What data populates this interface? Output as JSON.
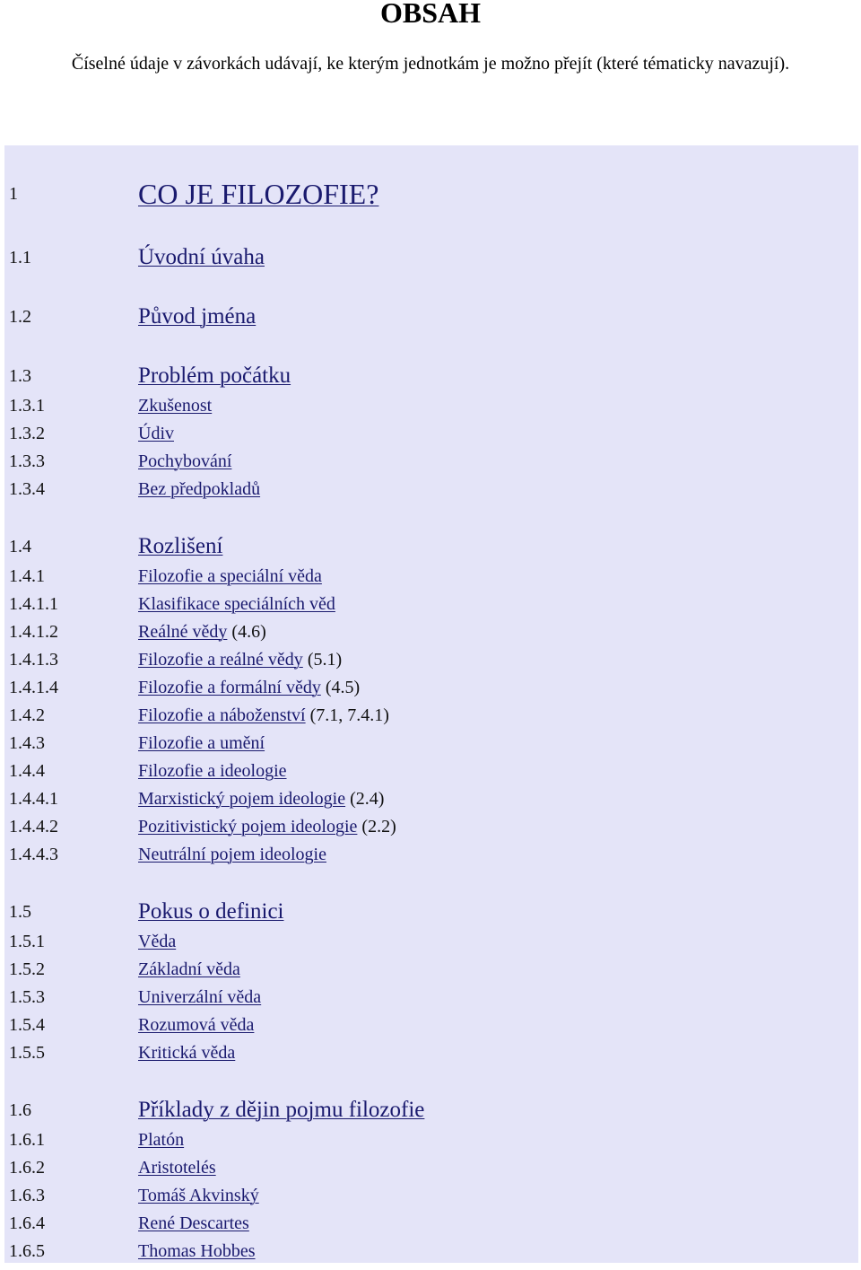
{
  "title": "OBSAH",
  "note": "Číselné údaje v závorkách udávají, ke kterým jednotkám je možno přejít (které tématicky navazují).",
  "colors": {
    "panel_bg": "#e4e4f8",
    "link": "#1a1a6e"
  },
  "toc": [
    {
      "num": "1",
      "label": "CO JE FILOZOFIE?",
      "ref": ""
    },
    {
      "num": "1.1",
      "label": "Úvodní úvaha",
      "ref": ""
    },
    {
      "num": "1.2",
      "label": "Původ jména",
      "ref": ""
    },
    {
      "num": "1.3",
      "label": "Problém počátku",
      "ref": ""
    },
    {
      "num": "1.3.1",
      "label": "Zkušenost",
      "ref": ""
    },
    {
      "num": "1.3.2",
      "label": "Údiv",
      "ref": ""
    },
    {
      "num": "1.3.3",
      "label": "Pochybování",
      "ref": ""
    },
    {
      "num": "1.3.4",
      "label": "Bez předpokladů",
      "ref": ""
    },
    {
      "num": "1.4",
      "label": "Rozlišení",
      "ref": ""
    },
    {
      "num": "1.4.1",
      "label": "Filozofie a speciální věda",
      "ref": ""
    },
    {
      "num": "1.4.1.1",
      "label": "Klasifikace speciálních věd",
      "ref": ""
    },
    {
      "num": "1.4.1.2",
      "label": "Reálné vědy",
      "ref": " (4.6)"
    },
    {
      "num": "1.4.1.3",
      "label": "Filozofie a reálné vědy",
      "ref": " (5.1)"
    },
    {
      "num": "1.4.1.4",
      "label": "Filozofie a formální vědy",
      "ref": " (4.5)"
    },
    {
      "num": "1.4.2",
      "label": "Filozofie a náboženství",
      "ref": " (7.1, 7.4.1)"
    },
    {
      "num": "1.4.3",
      "label": "Filozofie a umění",
      "ref": ""
    },
    {
      "num": "1.4.4",
      "label": "Filozofie a ideologie",
      "ref": ""
    },
    {
      "num": "1.4.4.1",
      "label": "Marxistický pojem ideologie",
      "ref": " (2.4)"
    },
    {
      "num": "1.4.4.2",
      "label": "Pozitivistický pojem ideologie",
      "ref": " (2.2)"
    },
    {
      "num": "1.4.4.3",
      "label": "Neutrální pojem ideologie",
      "ref": ""
    },
    {
      "num": "1.5",
      "label": "Pokus o definici",
      "ref": ""
    },
    {
      "num": "1.5.1",
      "label": "Věda",
      "ref": ""
    },
    {
      "num": "1.5.2",
      "label": "Základní věda",
      "ref": ""
    },
    {
      "num": "1.5.3",
      "label": "Univerzální věda",
      "ref": ""
    },
    {
      "num": "1.5.4",
      "label": "Rozumová věda",
      "ref": ""
    },
    {
      "num": "1.5.5",
      "label": "Kritická věda",
      "ref": ""
    },
    {
      "num": "1.6",
      "label": "Příklady z dějin pojmu filozofie",
      "ref": ""
    },
    {
      "num": "1.6.1",
      "label": "Platón",
      "ref": ""
    },
    {
      "num": "1.6.2",
      "label": "Aristotelés",
      "ref": ""
    },
    {
      "num": "1.6.3",
      "label": "Tomáš Akvinský",
      "ref": ""
    },
    {
      "num": "1.6.4",
      "label": "René Descartes",
      "ref": ""
    },
    {
      "num": "1.6.5",
      "label": "Thomas Hobbes",
      "ref": ""
    }
  ]
}
